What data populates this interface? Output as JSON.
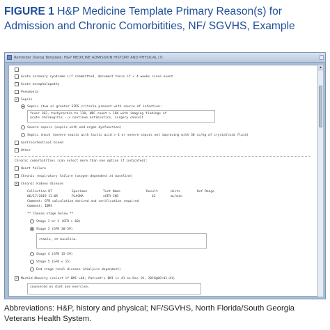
{
  "figure": {
    "label": "FIGURE 1",
    "title": "H&P Medicine Template Primary Reason(s) for Admission and Chronic Comorbitities, NF/ SGVHS, Example"
  },
  "window": {
    "title": "Reminder Dialog Template: H&P MEDICINE ADMISSION HISTORY AND PHYSICAL (?)"
  },
  "form": {
    "items": [
      {
        "label": "",
        "checked": false
      },
      {
        "label": "Acute coronary syndrome (if readmitted, document tnnis if < 4 weeks since event",
        "checked": false
      },
      {
        "label": "Acute encephalopathy",
        "checked": false
      },
      {
        "label": "Pneumonia",
        "checked": false
      },
      {
        "label": "Sepsis",
        "checked": true
      }
    ],
    "sepsis_options": [
      {
        "label": "Sepsis (two or greater SIRS criteria present with source of infection:",
        "selected": true
      },
      {
        "label": "Severe sepsis (sepsis with end-organ dysfunction)",
        "selected": false
      },
      {
        "label": "Septic shock (severe sepsis with lactic acid > 4 or severe sepsis not improving with 30 cc/kg of crystalloid fluid)",
        "selected": false
      }
    ],
    "sepsis_note": [
      "fever 102, tachycardia to 110, WBC count > 16K with imaging findings of",
      "acute cholangitis --> continue antibiotics, surgery consult"
    ],
    "items_after": [
      {
        "label": "Gastrointestinal bleed",
        "checked": false
      },
      {
        "label": "Other",
        "checked": false
      }
    ],
    "chronic_header": "Chronic comorbidities (can select more than one option if indicated):",
    "chronic_items": [
      {
        "label": "Heart failure",
        "checked": false
      },
      {
        "label": "Chronic respiratory failure (oxygen dependent at baseline)",
        "checked": false
      },
      {
        "label": "Chronic kidney disease",
        "checked": true
      }
    ],
    "lab_table": {
      "headers": [
        "Collection DT",
        "Specimen",
        "Test Name",
        "Result",
        "Units",
        "Ref Range"
      ],
      "row": [
        "06/17/2019 13:05",
        "PLASMA",
        "eGFR-CKD",
        "42",
        "mL/min",
        ""
      ],
      "comments": [
        "Comment: GFR calculation derived and verification required",
        "Comment: IDMS"
      ]
    },
    "stage_header": "** Choose stage below **",
    "stages": [
      {
        "label": "Stage 1 or 2  (GFR > 60)",
        "selected": false
      },
      {
        "label": "Stage 3  (GFR 30-59)",
        "selected": true
      },
      {
        "label": "Stage 4  (GFR 15-29)",
        "selected": false
      },
      {
        "label": "Stage 5  (GFR < 15)",
        "selected": false
      },
      {
        "label": "End stage renal disease  (dialysis dependent)",
        "selected": false
      }
    ],
    "stage_note": "stable, at baseline.",
    "bottom_items": [
      {
        "label": "Morbid Obesity  (select if BMI >40; Patient's BMI is 41 on Dec 19, 2019@09:01:41)",
        "checked": true
      }
    ],
    "bottom_note": "counseled on diet and exercise."
  },
  "caption": "Abbreviations: H&P, history and physical; NF/SGVHS, North Florida/South Georgia Veterans Health System."
}
